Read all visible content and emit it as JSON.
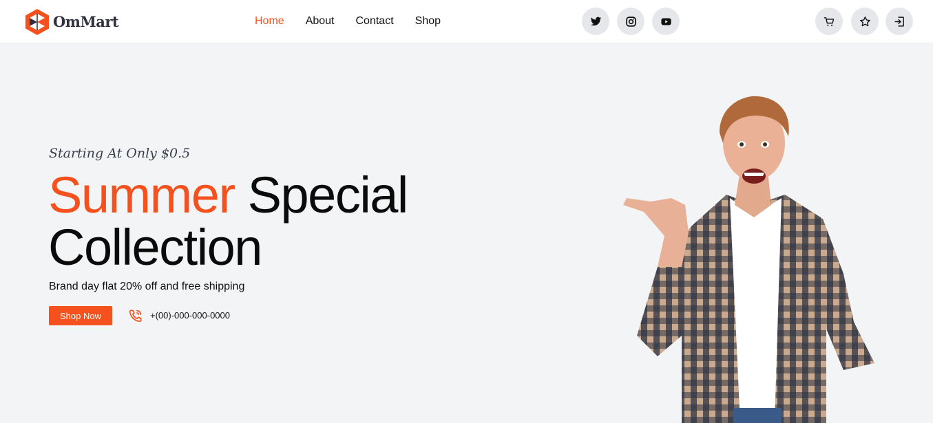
{
  "brand": {
    "name": "OmMart",
    "logo_icon": "hexagon-logo-icon"
  },
  "nav": {
    "links": [
      {
        "label": "Home",
        "active": true
      },
      {
        "label": "About",
        "active": false
      },
      {
        "label": "Contact",
        "active": false
      },
      {
        "label": "Shop",
        "active": false
      }
    ]
  },
  "social": [
    "twitter-icon",
    "instagram-icon",
    "youtube-icon"
  ],
  "actions": [
    "cart-icon",
    "star-icon",
    "login-icon"
  ],
  "hero": {
    "kicker": "Starting At Only $0.5",
    "title_accent": "Summer",
    "title_rest": "Special",
    "title_line2": "Collection",
    "subtitle": "Brand day flat 20% off and free shipping",
    "cta_label": "Shop Now",
    "phone": "+(00)-000-000-0000"
  },
  "colors": {
    "accent": "#f4511e",
    "page_bg": "#f3f4f6",
    "nav_bg": "#ffffff",
    "icon_bg": "#e6e7ea"
  }
}
